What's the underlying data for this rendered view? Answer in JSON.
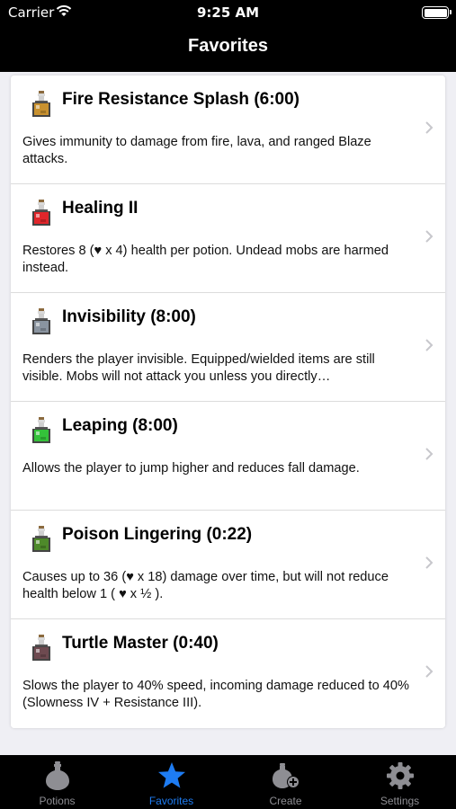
{
  "status_bar": {
    "carrier": "Carrier",
    "time": "9:25 AM"
  },
  "nav": {
    "title": "Favorites"
  },
  "favorites": [
    {
      "title": "Fire Resistance Splash (6:00)",
      "description": "Gives immunity to damage from fire, lava, and ranged Blaze attacks.",
      "icon": "splash-potion-orange-icon",
      "color": "#c8912f"
    },
    {
      "title": "Healing II",
      "description": "Restores 8 (♥ x 4) health per potion. Undead mobs are harmed instead.",
      "icon": "potion-red-icon",
      "color": "#e0262b"
    },
    {
      "title": "Invisibility (8:00)",
      "description": "Renders the player invisible. Equipped/wielded items are still visible. Mobs will not attack you unless you directly…",
      "icon": "potion-gray-icon",
      "color": "#8a94a0"
    },
    {
      "title": "Leaping (8:00)",
      "description": "Allows the player to jump higher and reduces fall damage.",
      "icon": "potion-green-icon",
      "color": "#34c23a"
    },
    {
      "title": "Poison Lingering (0:22)",
      "description": "Causes up to 36 (♥ x 18) damage over time, but will not reduce health below 1 ( ♥ x ½ ).",
      "icon": "lingering-potion-green-icon",
      "color": "#4e8a2a"
    },
    {
      "title": "Turtle Master (0:40)",
      "description": "Slows the player to 40% speed, incoming damage reduced to 40%  (Slowness IV + Resistance III).",
      "icon": "potion-brown-icon",
      "color": "#6e4a50"
    }
  ],
  "tabs": [
    {
      "label": "Potions",
      "icon": "potion-icon",
      "active": false
    },
    {
      "label": "Favorites",
      "icon": "star-icon",
      "active": true
    },
    {
      "label": "Create",
      "icon": "create-potion-icon",
      "active": false
    },
    {
      "label": "Settings",
      "icon": "gear-icon",
      "active": false
    }
  ],
  "colors": {
    "accent": "#1e7cf2",
    "inactive_tab": "#8e8e93",
    "bar_background": "#000000"
  }
}
